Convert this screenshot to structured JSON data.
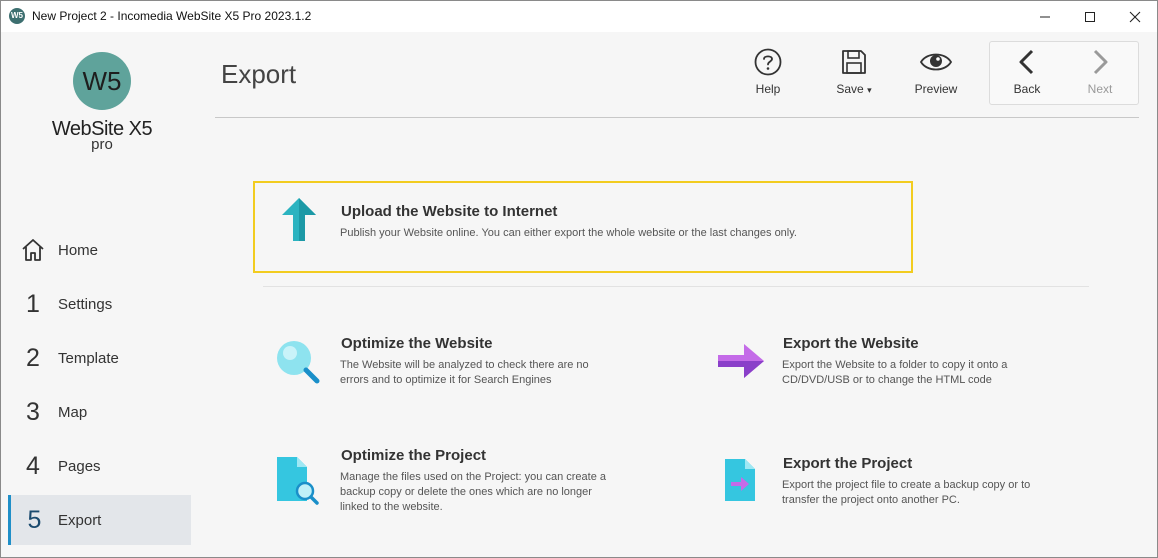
{
  "window": {
    "app_icon_text": "W5",
    "title": "New Project 2 - Incomedia WebSite X5 Pro 2023.1.2"
  },
  "logo": {
    "mark": "W5",
    "name": "WebSite X5",
    "edition": "pro"
  },
  "sidebar": {
    "items": [
      {
        "num": "",
        "icon": "home-icon",
        "label": "Home"
      },
      {
        "num": "1",
        "label": "Settings"
      },
      {
        "num": "2",
        "label": "Template"
      },
      {
        "num": "3",
        "label": "Map"
      },
      {
        "num": "4",
        "label": "Pages"
      },
      {
        "num": "5",
        "label": "Export",
        "active": true
      }
    ]
  },
  "page": {
    "title": "Export"
  },
  "toolbar": {
    "help": "Help",
    "save": "Save",
    "save_caret": "▾",
    "preview": "Preview",
    "back": "Back",
    "next": "Next"
  },
  "options": {
    "upload": {
      "title": "Upload the Website to Internet",
      "desc": "Publish your Website online. You can either export the whole website or the last changes only."
    },
    "optimize_website": {
      "title": "Optimize the Website",
      "desc1": "The Website will be analyzed to check there are no",
      "desc2": "errors and to optimize it for Search Engines"
    },
    "export_website": {
      "title": "Export the Website",
      "desc1": "Export the Website to a folder to copy it onto a",
      "desc2": "CD/DVD/USB or to change the HTML code"
    },
    "optimize_project": {
      "title": "Optimize the Project",
      "desc1": "Manage the files used on the Project: you can create a",
      "desc2": "backup copy or delete the ones which are no longer",
      "desc3": "linked to the website."
    },
    "export_project": {
      "title": "Export the Project",
      "desc1": "Export the project file to create a backup copy or to",
      "desc2": "transfer the project onto another PC."
    }
  },
  "colors": {
    "accent_blue": "#1f8fc8",
    "highlight_yellow": "#f2cc1f",
    "upload_teal": "#2bb3c0",
    "export_purple": "#9b4fd6",
    "logo_teal": "#5fa39b"
  }
}
